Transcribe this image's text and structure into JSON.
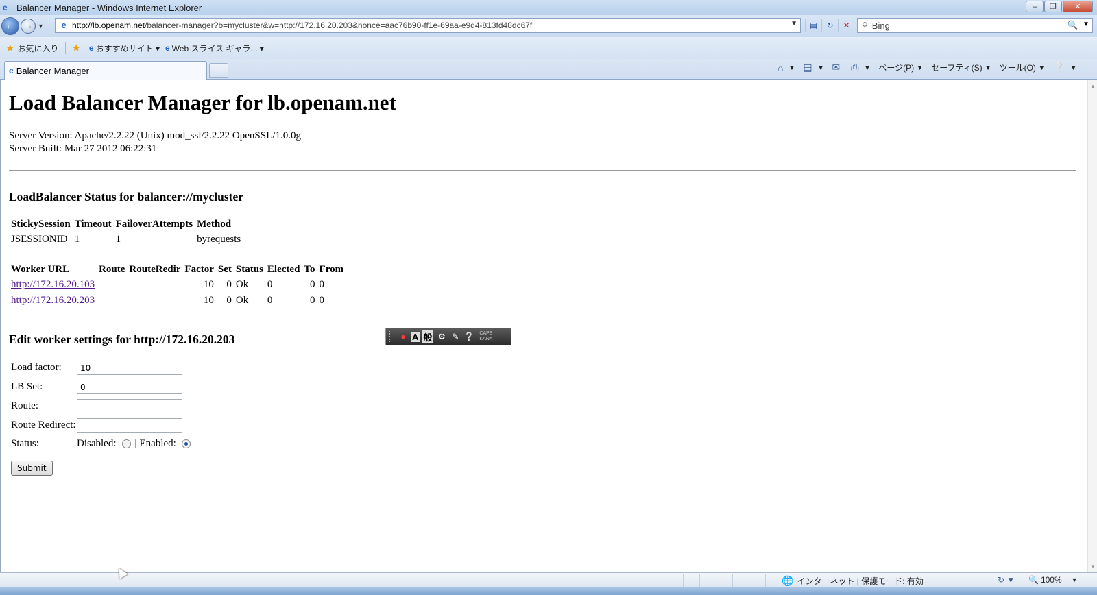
{
  "window": {
    "title": "Balancer Manager - Windows Internet Explorer"
  },
  "nav": {
    "url_host": "http://lb.openam.net",
    "url_rest": "/balancer-manager?b=mycluster&w=http://172.16.20.203&nonce=aac76b90-ff1e-69aa-e9d4-813fd48dc67f",
    "search_placeholder": "Bing"
  },
  "favorites": {
    "favorites_label": "お気に入り",
    "items": [
      "おすすめサイト ▾",
      "Web スライス ギャラ... ▾"
    ]
  },
  "tab": {
    "label": "Balancer Manager"
  },
  "commands": [
    "ページ(P)",
    "セーフティ(S)",
    "ツール(O)"
  ],
  "page": {
    "heading": "Load Balancer Manager for lb.openam.net",
    "server_version": "Server Version: Apache/2.2.22 (Unix) mod_ssl/2.2.22 OpenSSL/1.0.0g",
    "server_built": "Server Built: Mar 27 2012 06:22:31",
    "status_heading": "LoadBalancer Status for balancer://mycluster",
    "balancer_table": {
      "headers": [
        "StickySession",
        "Timeout",
        "FailoverAttempts",
        "Method"
      ],
      "row": [
        "JSESSIONID",
        "1",
        "1",
        "byrequests"
      ]
    },
    "workers_table": {
      "headers": [
        "Worker URL",
        "Route",
        "RouteRedir",
        "Factor",
        "Set",
        "Status",
        "Elected",
        "To",
        "From"
      ],
      "rows": [
        [
          "http://172.16.20.103",
          "",
          "",
          "10",
          "0",
          "Ok",
          "0",
          "0",
          "0"
        ],
        [
          "http://172.16.20.203",
          "",
          "",
          "10",
          "0",
          "Ok",
          "0",
          "0",
          "0"
        ]
      ]
    },
    "edit_heading": "Edit worker settings for http://172.16.20.203",
    "form": {
      "load_factor_label": "Load factor:",
      "load_factor_value": "10",
      "lb_set_label": "LB Set:",
      "lb_set_value": "0",
      "route_label": "Route:",
      "route_value": "",
      "route_redirect_label": "Route Redirect:",
      "route_redirect_value": "",
      "status_label": "Status:",
      "disabled_label": "Disabled:",
      "separator": "|",
      "enabled_label": "Enabled:",
      "status_selected": "Enabled",
      "submit_label": "Submit"
    }
  },
  "ime": {
    "mode": "A",
    "mode2": "般",
    "caps": "CAPS",
    "kana": "KANA"
  },
  "statusbar": {
    "zone": "インターネット | 保護モード: 有効",
    "zoom": "100%"
  }
}
